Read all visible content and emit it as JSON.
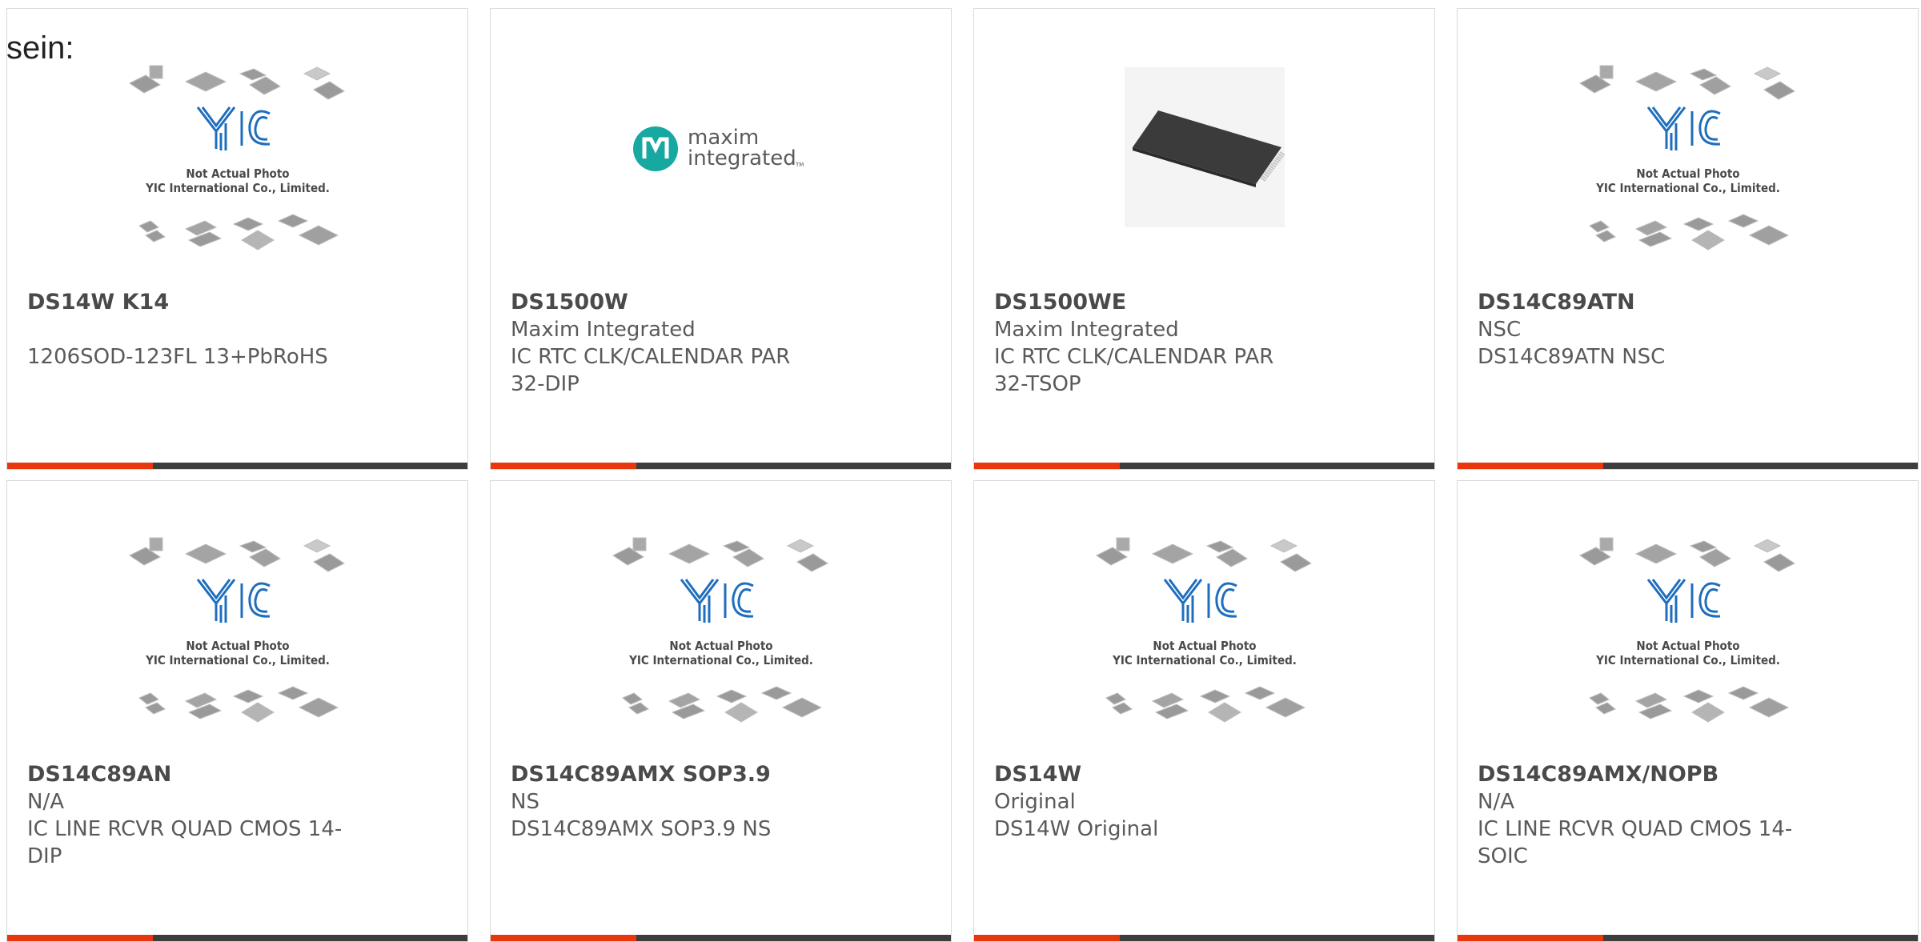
{
  "intro_text": "sein:",
  "placeholder": {
    "line1": "Not Actual Photo",
    "line2": "YIC International Co., Limited."
  },
  "logo": {
    "line1": "maxim",
    "line2": "integrated",
    "tm": "TM"
  },
  "colors": {
    "accent": "#e8360e",
    "bar": "#3d3d3d",
    "yic_blue": "#1f6ebd",
    "maxim_teal": "#17a8a1"
  },
  "products": [
    {
      "name": "DS14W K14",
      "manufacturer": "",
      "description": "1206SOD-123FL 13+PbRoHS",
      "image": "yic-placeholder"
    },
    {
      "name": "DS1500W",
      "manufacturer": "Maxim Integrated",
      "description": "IC RTC CLK/CALENDAR PAR 32-DIP",
      "image": "maxim-logo"
    },
    {
      "name": "DS1500WE",
      "manufacturer": "Maxim Integrated",
      "description": "IC RTC CLK/CALENDAR PAR 32-TSOP",
      "image": "tsop-chip"
    },
    {
      "name": "DS14C89ATN",
      "manufacturer": "NSC",
      "description": "DS14C89ATN NSC",
      "image": "yic-placeholder"
    },
    {
      "name": "DS14C89AN",
      "manufacturer": "N/A",
      "description": "IC LINE RCVR QUAD CMOS 14-DIP",
      "image": "yic-placeholder"
    },
    {
      "name": "DS14C89AMX SOP3.9",
      "manufacturer": "NS",
      "description": "DS14C89AMX SOP3.9 NS",
      "image": "yic-placeholder"
    },
    {
      "name": "DS14W",
      "manufacturer": "Original",
      "description": "DS14W Original",
      "image": "yic-placeholder"
    },
    {
      "name": "DS14C89AMX/NOPB",
      "manufacturer": "N/A",
      "description": "IC LINE RCVR QUAD CMOS 14-SOIC",
      "image": "yic-placeholder"
    }
  ]
}
